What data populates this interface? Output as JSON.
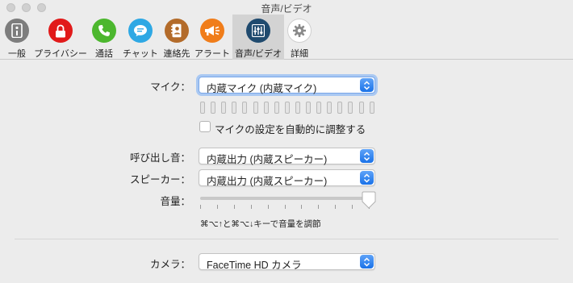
{
  "window": {
    "title": "音声/ビデオ"
  },
  "toolbar": {
    "items": [
      {
        "label": "一般",
        "icon": "general-switch-icon",
        "color": "#7d7d7d"
      },
      {
        "label": "プライバシー",
        "icon": "lock-icon",
        "color": "#e11a1a"
      },
      {
        "label": "通話",
        "icon": "phone-icon",
        "color": "#4cb72e"
      },
      {
        "label": "チャット",
        "icon": "chat-bubble-icon",
        "color": "#2ea8e4"
      },
      {
        "label": "連絡先",
        "icon": "address-book-icon",
        "color": "#b36b2a"
      },
      {
        "label": "アラート",
        "icon": "megaphone-icon",
        "color": "#f07d1a"
      },
      {
        "label": "音声/ビデオ",
        "icon": "audio-mixer-icon",
        "color": "#1f4a6e",
        "selected": true
      },
      {
        "label": "詳細",
        "icon": "gear-icon",
        "color": "#8a8a8a"
      }
    ]
  },
  "microphone": {
    "label": "マイク：",
    "value": "内蔵マイク (内蔵マイク)",
    "level_bars": 17,
    "auto_adjust": {
      "label": "マイクの設定を自動的に調整する",
      "checked": false
    }
  },
  "ringer": {
    "label": "呼び出し音：",
    "value": "内蔵出力 (内蔵スピーカー)"
  },
  "speaker": {
    "label": "スピーカー：",
    "value": "内蔵出力 (内蔵スピーカー)"
  },
  "volume": {
    "label": "音量：",
    "level": 1.0,
    "ticks": 11,
    "hint": "⌘⌥↑と⌘⌥↓キーで音量を調節"
  },
  "camera": {
    "label": "カメラ：",
    "value": "FaceTime HD カメラ"
  },
  "colors": {
    "accent": "#1a72e8",
    "focus_ring": "#a9c8f2"
  }
}
